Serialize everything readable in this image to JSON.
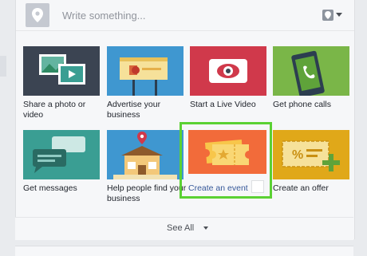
{
  "composer": {
    "placeholder": "Write something...",
    "avatar_icon": "location-pin-icon",
    "location_icon": "location-pin-icon"
  },
  "options": [
    {
      "label": "Share a photo or video",
      "icon": "photo-video-icon",
      "color": "#3b4452"
    },
    {
      "label": "Advertise your business",
      "icon": "billboard-icon",
      "color": "#3f97d0"
    },
    {
      "label": "Start a Live Video",
      "icon": "live-video-icon",
      "color": "#d0394b"
    },
    {
      "label": "Get phone calls",
      "icon": "phone-call-icon",
      "color": "#7ab648"
    },
    {
      "label": "Get messages",
      "icon": "messages-icon",
      "color": "#3a9e93"
    },
    {
      "label": "Help people find your business",
      "icon": "storefront-icon",
      "color": "#3f97d0"
    },
    {
      "label": "Create an event",
      "icon": "event-ticket-icon",
      "color": "#f26b3a"
    },
    {
      "label": "Create an offer",
      "icon": "offer-coupon-icon",
      "color": "#e0a819"
    }
  ],
  "footer": {
    "see_all": "See All"
  },
  "colors": {
    "highlight": "#5bd133",
    "link": "#365899"
  }
}
